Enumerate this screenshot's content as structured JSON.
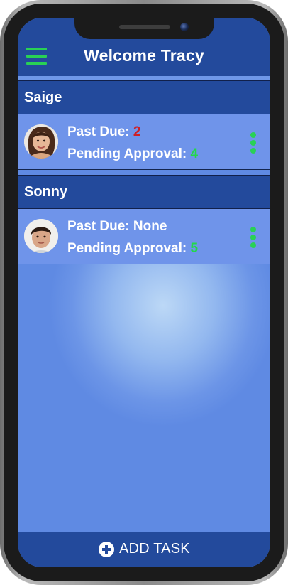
{
  "header": {
    "title": "Welcome Tracy",
    "menu_icon": "hamburger-menu-icon"
  },
  "children": [
    {
      "name": "Saige",
      "avatar": "girl-avatar",
      "past_due_label": "Past Due:",
      "past_due_value": "2",
      "pending_label": "Pending Approval:",
      "pending_value": "4",
      "more_icon": "vertical-dots-icon"
    },
    {
      "name": "Sonny",
      "avatar": "boy-avatar",
      "past_due_label": "Past Due:",
      "past_due_value": "None",
      "pending_label": "Pending Approval:",
      "pending_value": "5",
      "more_icon": "vertical-dots-icon"
    }
  ],
  "footer": {
    "add_label": "ADD TASK",
    "add_icon": "plus-circle-icon"
  },
  "colors": {
    "primary": "#234a9c",
    "accent_green": "#29d155",
    "alert_red": "#cf1f25",
    "row_bg": "#6f94ea"
  }
}
